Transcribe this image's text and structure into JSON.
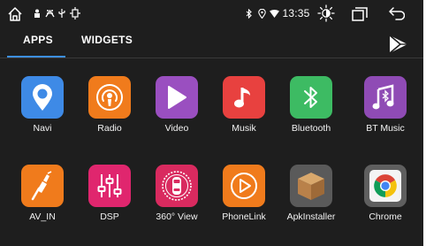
{
  "status_bar": {
    "icons_left": [
      "home-icon",
      "usb-icon",
      "adb-icon",
      "usb-plug-icon",
      "gps-icon"
    ],
    "icons_right": [
      "bluetooth-icon",
      "location-icon",
      "wifi-icon"
    ],
    "time": "13:35",
    "buttons": [
      "brightness-icon",
      "recent-apps-icon",
      "back-icon"
    ]
  },
  "tabs": [
    {
      "label": "APPS",
      "active": true
    },
    {
      "label": "WIDGETS",
      "active": false
    }
  ],
  "store_icon": "play-store-icon",
  "apps": [
    {
      "label": "Navi",
      "color": "#3e8ae6",
      "icon": "location-pin-icon"
    },
    {
      "label": "Radio",
      "color": "#f07b1c",
      "icon": "podcast-icon"
    },
    {
      "label": "Video",
      "color": "#9a4fc0",
      "icon": "play-icon"
    },
    {
      "label": "Musik",
      "color": "#e8413f",
      "icon": "music-note-icon"
    },
    {
      "label": "Bluetooth",
      "color": "#3dbb63",
      "icon": "bluetooth-icon"
    },
    {
      "label": "BT Music",
      "color": "#8f4bb5",
      "icon": "music-bluetooth-icon"
    },
    {
      "label": "AV_IN",
      "color": "#f07b1c",
      "icon": "av-cable-icon"
    },
    {
      "label": "DSP",
      "color": "#e0266e",
      "icon": "equalizer-icon"
    },
    {
      "label": "360° View",
      "color": "#d92a5f",
      "icon": "car-top-view-icon"
    },
    {
      "label": "PhoneLink",
      "color": "#f07b1c",
      "icon": "phonelink-icon"
    },
    {
      "label": "ApkInstaller",
      "color": "#5a5a5a",
      "icon": "package-box-icon"
    },
    {
      "label": "Chrome",
      "color": "#5f5f5f",
      "icon": "chrome-icon"
    }
  ]
}
